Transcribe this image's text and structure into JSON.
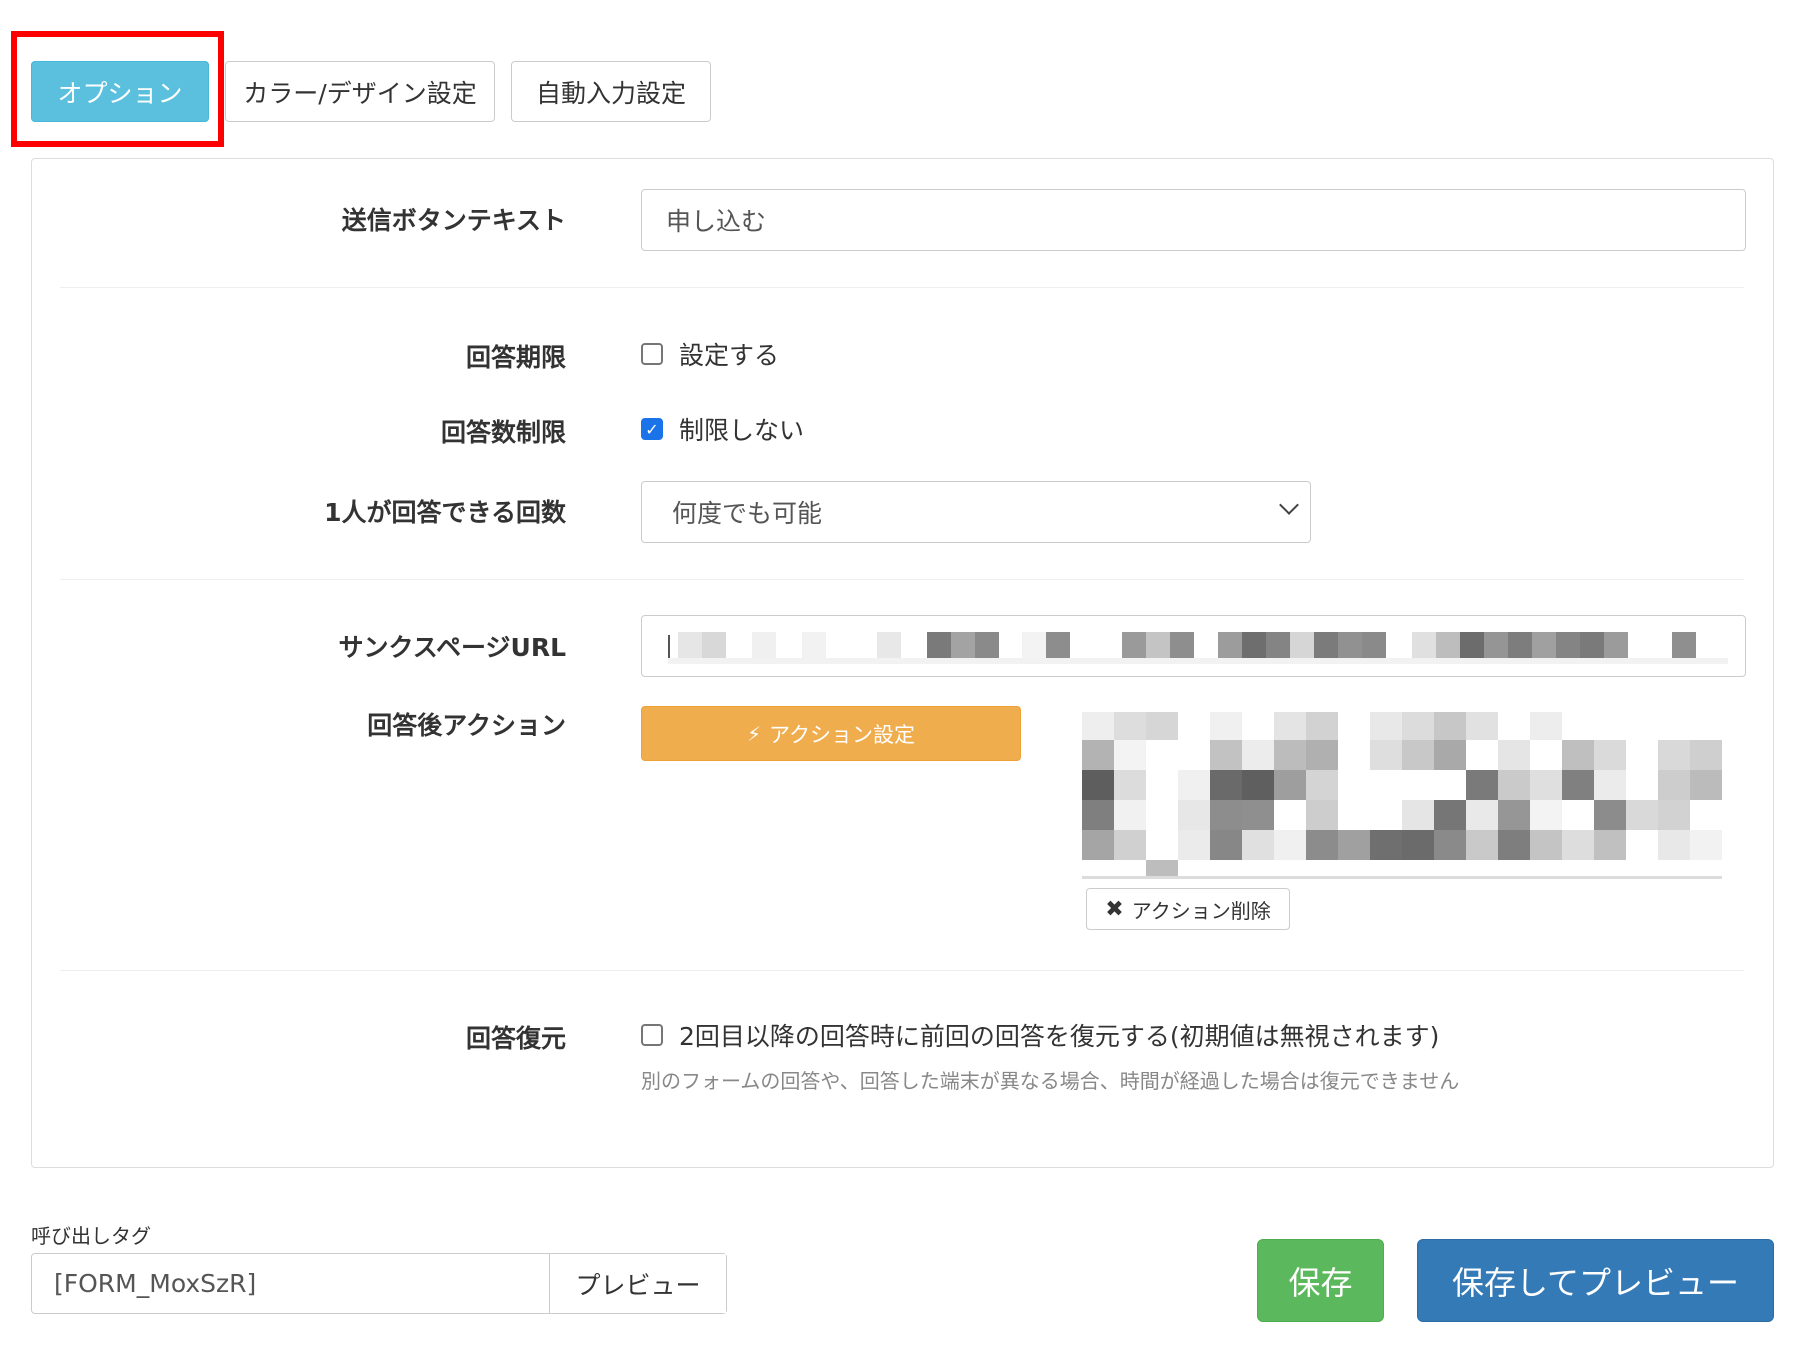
{
  "tabs": [
    {
      "label": "オプション",
      "active": true
    },
    {
      "label": "カラー/デザイン設定",
      "active": false
    },
    {
      "label": "自動入力設定",
      "active": false
    }
  ],
  "submit_text": {
    "label": "送信ボタンテキスト",
    "value": "申し込む"
  },
  "deadline": {
    "label": "回答期限",
    "checkbox_label": "設定する",
    "checked": false
  },
  "response_limit": {
    "label": "回答数制限",
    "checkbox_label": "制限しない",
    "checked": true
  },
  "per_person": {
    "label": "1人が回答できる回数",
    "selected": "何度でも可能"
  },
  "thanks_url": {
    "label": "サンクスページURL"
  },
  "after_action": {
    "label": "回答後アクション",
    "button_label": "アクション設定",
    "delete_label": "アクション削除"
  },
  "restore": {
    "label": "回答復元",
    "checkbox_label": "2回目以降の回答時に前回の回答を復元する(初期値は無視されます)",
    "checked": false,
    "help": "別のフォームの回答や、回答した端末が異なる場合、時間が経過した場合は復元できません"
  },
  "call_tag": {
    "label": "呼び出しタグ",
    "value": "[FORM_MoxSzR]",
    "preview_label": "プレビュー"
  },
  "footer": {
    "save_label": "保存",
    "save_preview_label": "保存してプレビュー"
  },
  "colors": {
    "info": "#5bc0de",
    "warning": "#f0ad4e",
    "success": "#5cb85c",
    "primary": "#337ab7",
    "highlight": "#ff0000"
  }
}
